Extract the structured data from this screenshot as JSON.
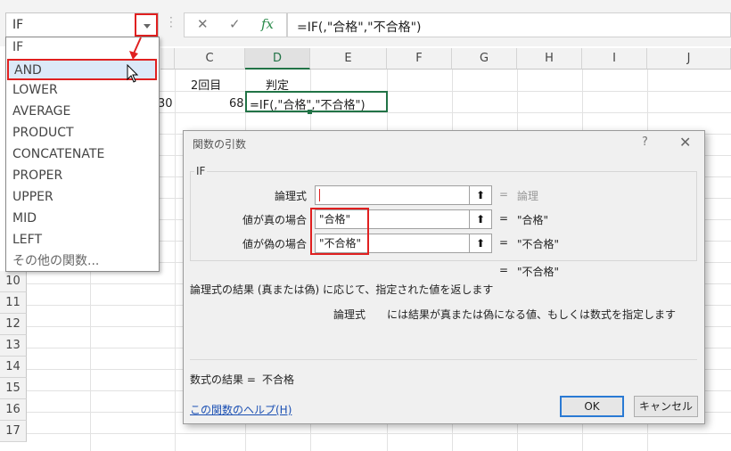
{
  "namebox": {
    "value": "IF"
  },
  "formula_bar": {
    "cancel_icon": "✕",
    "enter_icon": "✓",
    "fx_label": "fx",
    "formula": "=IF(,\"合格\",\"不合格\")"
  },
  "columns": [
    "C",
    "D",
    "E",
    "F",
    "G",
    "H",
    "I",
    "J"
  ],
  "row_numbers": [
    "10",
    "11",
    "12",
    "13",
    "14",
    "15",
    "16",
    "17"
  ],
  "cells": {
    "c1": "2回目",
    "d1": "判定",
    "b2_partial": "30",
    "c2": "68",
    "d2": "=IF(,\"合格\",\"不合格\")"
  },
  "function_list": {
    "items": [
      "IF",
      "AND",
      "LOWER",
      "AVERAGE",
      "PRODUCT",
      "CONCATENATE",
      "PROPER",
      "UPPER",
      "MID",
      "LEFT",
      "その他の関数..."
    ],
    "highlighted_index": 1
  },
  "dialog": {
    "title": "関数の引数",
    "help_symbol": "?",
    "close_symbol": "✕",
    "function_name": "IF",
    "arguments": [
      {
        "label": "論理式",
        "value": "",
        "result": "論理",
        "result_gray": true
      },
      {
        "label": "値が真の場合",
        "value": "\"合格\"",
        "result": "\"合格\""
      },
      {
        "label": "値が偽の場合",
        "value": "\"不合格\"",
        "result": "\"不合格\""
      }
    ],
    "ref_button_symbol": "⬆",
    "equals": "=",
    "overall_result": "\"不合格\"",
    "description": "論理式の結果 (真または偽) に応じて、指定された値を返します",
    "arg_help_name": "論理式",
    "arg_help_text": "には結果が真または偽になる値、もしくは数式を指定します",
    "formula_result_label": "数式の結果 =",
    "formula_result_value": "不合格",
    "help_link": "この関数のヘルプ(H)",
    "ok_label": "OK",
    "cancel_label": "キャンセル"
  },
  "colors": {
    "accent_red": "#e02020",
    "excel_green": "#217346",
    "link_blue": "#1a4fb3"
  }
}
